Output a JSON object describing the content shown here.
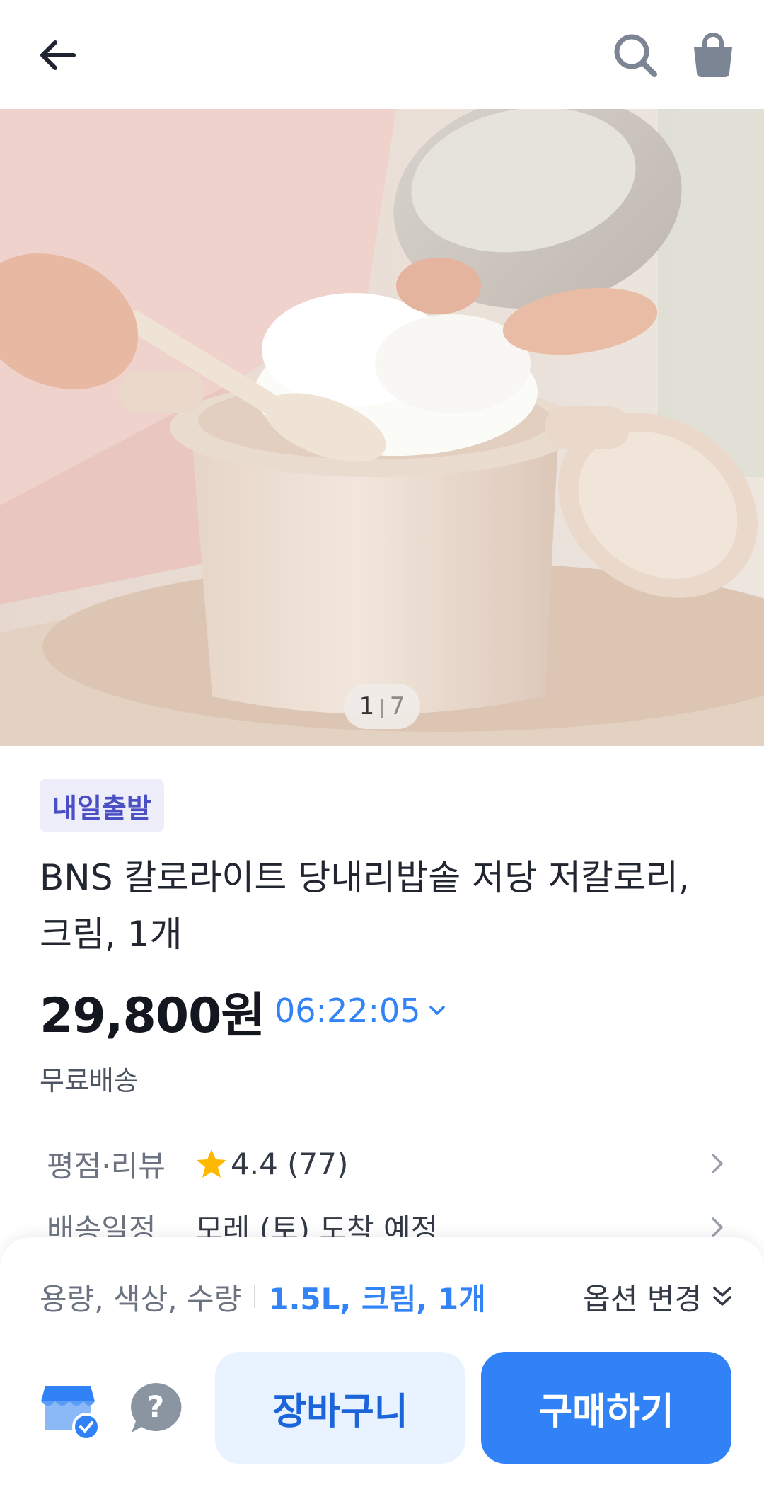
{
  "header": {
    "back_icon": "arrow-left-icon",
    "search_icon": "search-icon",
    "cart_icon": "shopping-bag-icon"
  },
  "gallery": {
    "current": "1",
    "separator": "|",
    "total": "7"
  },
  "product": {
    "badge": "내일출발",
    "title": "BNS 칼로라이트 당내리밥솥 저당 저칼로리, 크림, 1개",
    "price": "29,800원",
    "timer": "06:22:05",
    "shipping": "무료배송"
  },
  "info": {
    "rating_label": "평점·리뷰",
    "rating_value": "4.4 (77)",
    "delivery_label": "배송일정",
    "delivery_value": "모레 (토) 도착 예정"
  },
  "sheet": {
    "option_label": "용량, 색상, 수량",
    "option_value": "1.5L, 크림, 1개",
    "option_change": "옵션 변경",
    "cart_button": "장바구니",
    "buy_button": "구매하기"
  },
  "colors": {
    "accent": "#3182f6",
    "badge_bg": "#eeeefb",
    "badge_text": "#4b4fc4",
    "star": "#ffb800"
  }
}
